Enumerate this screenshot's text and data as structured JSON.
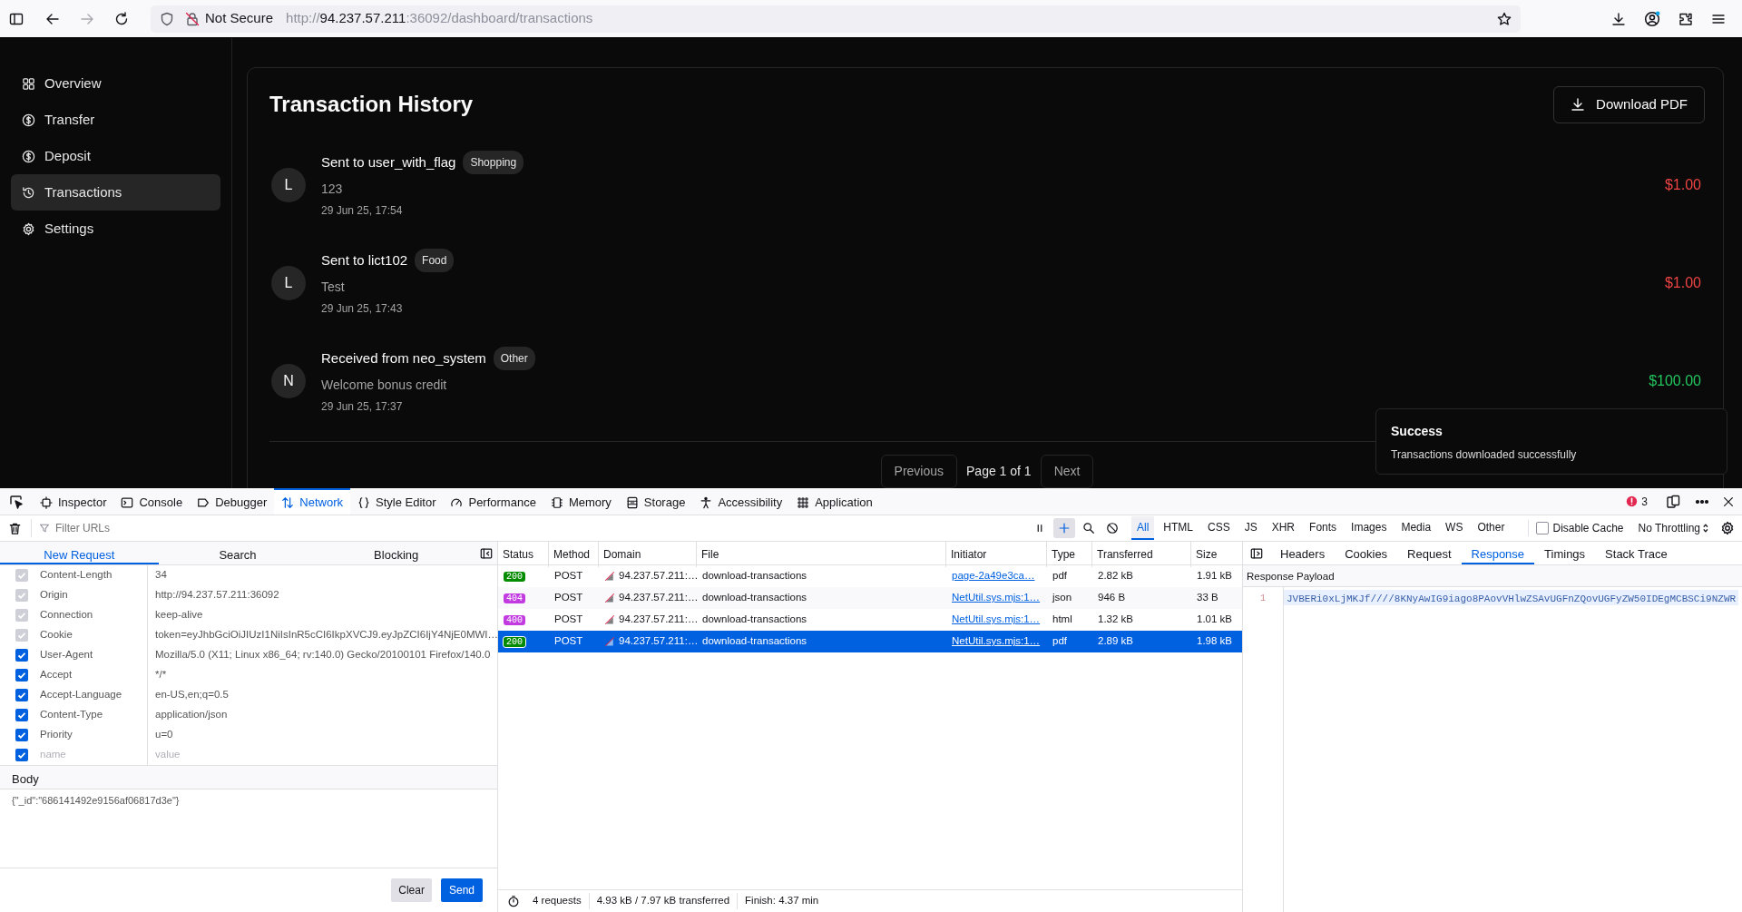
{
  "browser": {
    "security": "Not Secure",
    "url": "http://**94.237.57.211**:36092/dashboard/transactions"
  },
  "sidebar": {
    "items": [
      {
        "label": "Overview",
        "selected": false
      },
      {
        "label": "Transfer",
        "selected": false
      },
      {
        "label": "Deposit",
        "selected": false
      },
      {
        "label": "Transactions",
        "selected": true
      },
      {
        "label": "Settings",
        "selected": false
      }
    ]
  },
  "page": {
    "title": "Transaction History",
    "download_button": "Download PDF",
    "transactions": [
      {
        "avatar": "L",
        "title": "Sent to user_with_flag",
        "tag": "Shopping",
        "note": "123",
        "time": "29 Jun 25, 17:54",
        "amount": "$1.00",
        "kind": "sent"
      },
      {
        "avatar": "L",
        "title": "Sent to lict102",
        "tag": "Food",
        "note": "Test",
        "time": "29 Jun 25, 17:43",
        "amount": "$1.00",
        "kind": "sent"
      },
      {
        "avatar": "N",
        "title": "Received from neo_system",
        "tag": "Other",
        "note": "Welcome bonus credit",
        "time": "29 Jun 25, 17:37",
        "amount": "$100.00",
        "kind": "received"
      }
    ],
    "pagination": {
      "previous": "Previous",
      "page": "Page 1 of 1",
      "next": "Next"
    }
  },
  "toast": {
    "title": "Success",
    "message": "Transactions downloaded successfully"
  },
  "devtools": {
    "tabs": [
      {
        "label": "Inspector",
        "selected": false
      },
      {
        "label": "Console",
        "selected": false
      },
      {
        "label": "Debugger",
        "selected": false
      },
      {
        "label": "Network",
        "selected": true
      },
      {
        "label": "Style Editor",
        "selected": false
      },
      {
        "label": "Performance",
        "selected": false
      },
      {
        "label": "Memory",
        "selected": false
      },
      {
        "label": "Storage",
        "selected": false
      },
      {
        "label": "Accessibility",
        "selected": false
      },
      {
        "label": "Application",
        "selected": false
      }
    ],
    "error_count": "3",
    "filter": {
      "placeholder": "Filter URLs"
    },
    "type_filters": [
      {
        "label": "All",
        "selected": true
      },
      {
        "label": "HTML",
        "selected": false
      },
      {
        "label": "CSS",
        "selected": false
      },
      {
        "label": "JS",
        "selected": false
      },
      {
        "label": "XHR",
        "selected": false
      },
      {
        "label": "Fonts",
        "selected": false
      },
      {
        "label": "Images",
        "selected": false
      },
      {
        "label": "Media",
        "selected": false
      },
      {
        "label": "WS",
        "selected": false
      },
      {
        "label": "Other",
        "selected": false
      }
    ],
    "disable_cache": {
      "label": "Disable Cache",
      "checked": false
    },
    "throttling": "No Throttling",
    "request_panel": {
      "tabs": [
        {
          "label": "New Request",
          "selected": true
        },
        {
          "label": "Search",
          "selected": false
        },
        {
          "label": "Blocking",
          "selected": false
        }
      ],
      "headers": [
        {
          "name": "Content-Length",
          "value": "34",
          "checked": true,
          "disabled": true
        },
        {
          "name": "Origin",
          "value": "http://94.237.57.211:36092",
          "checked": true,
          "disabled": true
        },
        {
          "name": "Connection",
          "value": "keep-alive",
          "checked": true,
          "disabled": true
        },
        {
          "name": "Cookie",
          "value": "token=eyJhbGciOiJIUzI1NiIsInR5cCI6IkpXVCJ9.eyJpZCI6IjY4NjE0MWI…",
          "checked": true,
          "disabled": true
        },
        {
          "name": "User-Agent",
          "value": "Mozilla/5.0 (X11; Linux x86_64; rv:140.0) Gecko/20100101 Firefox/140.0",
          "checked": true,
          "disabled": false
        },
        {
          "name": "Accept",
          "value": "*/*",
          "checked": true,
          "disabled": false
        },
        {
          "name": "Accept-Language",
          "value": "en-US,en;q=0.5",
          "checked": true,
          "disabled": false
        },
        {
          "name": "Content-Type",
          "value": "application/json",
          "checked": true,
          "disabled": false
        },
        {
          "name": "Priority",
          "value": "u=0",
          "checked": true,
          "disabled": false
        }
      ],
      "new_header": {
        "name_placeholder": "name",
        "value_placeholder": "value",
        "checked": true
      },
      "body_label": "Body",
      "body": "{\"_id\":\"686141492e9156af06817d3e\"}",
      "clear_button": "Clear",
      "send_button": "Send"
    },
    "network": {
      "columns": [
        "Status",
        "Method",
        "Domain",
        "File",
        "Initiator",
        "Type",
        "Transferred",
        "Size"
      ],
      "rows": [
        {
          "status": "200",
          "color": "#058b00",
          "method": "POST",
          "domain": "94.237.57.211:…",
          "file": "download-transactions",
          "initiator": "page-2a49e3ca…",
          "type": "pdf",
          "transferred": "2.82 kB",
          "size": "1.91 kB",
          "selected": false
        },
        {
          "status": "404",
          "color": "#c13be0",
          "method": "POST",
          "domain": "94.237.57.211:…",
          "file": "download-transactions",
          "initiator": "NetUtil.sys.mjs:1…",
          "type": "json",
          "transferred": "946 B",
          "size": "33 B",
          "selected": false
        },
        {
          "status": "400",
          "color": "#c13be0",
          "method": "POST",
          "domain": "94.237.57.211:…",
          "file": "download-transactions",
          "initiator": "NetUtil.sys.mjs:1…",
          "type": "html",
          "transferred": "1.32 kB",
          "size": "1.01 kB",
          "selected": false
        },
        {
          "status": "200",
          "color": "#058b00",
          "method": "POST",
          "domain": "94.237.57.211:…",
          "file": "download-transactions",
          "initiator": "NetUtil.sys.mjs:1…",
          "type": "pdf",
          "transferred": "2.89 kB",
          "size": "1.98 kB",
          "selected": true
        }
      ],
      "summary": {
        "requests": "4 requests",
        "transferred": "4.93 kB / 7.97 kB transferred",
        "finish": "Finish: 4.37 min"
      }
    },
    "response_panel": {
      "tabs": [
        {
          "label": "Headers",
          "selected": false
        },
        {
          "label": "Cookies",
          "selected": false
        },
        {
          "label": "Request",
          "selected": false
        },
        {
          "label": "Response",
          "selected": true
        },
        {
          "label": "Timings",
          "selected": false
        },
        {
          "label": "Stack Trace",
          "selected": false
        }
      ],
      "payload_title": "Response Payload",
      "lines": [
        {
          "number": "1",
          "text": "JVBERi0xLjMKJf////8KNyAwIG9iago8PAovVHlwZSAvUGFnZQovUGFyZW50IDEgMCBSCi9NZWR"
        }
      ]
    }
  }
}
